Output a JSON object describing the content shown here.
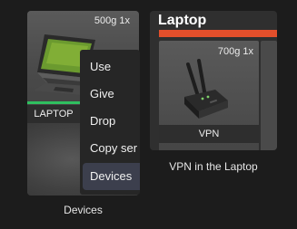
{
  "left_inventory": {
    "slot": {
      "weight_label": "500g 1x",
      "item_name": "LAPTOP",
      "icon": "laptop-icon",
      "durability": 0.47,
      "durability_color": "#2fbf5f"
    },
    "label": "Devices"
  },
  "context_menu": {
    "items": [
      {
        "label": "Use"
      },
      {
        "label": "Give"
      },
      {
        "label": "Drop"
      },
      {
        "label": "Copy ser"
      },
      {
        "label": "Devices"
      }
    ],
    "active_index": 4
  },
  "right_panel": {
    "title": "Laptop",
    "bar_color": "#e34f2b",
    "slot": {
      "weight_label": "700g 1x",
      "item_name": "VPN",
      "icon": "router-icon"
    },
    "label": "VPN in the Laptop"
  }
}
